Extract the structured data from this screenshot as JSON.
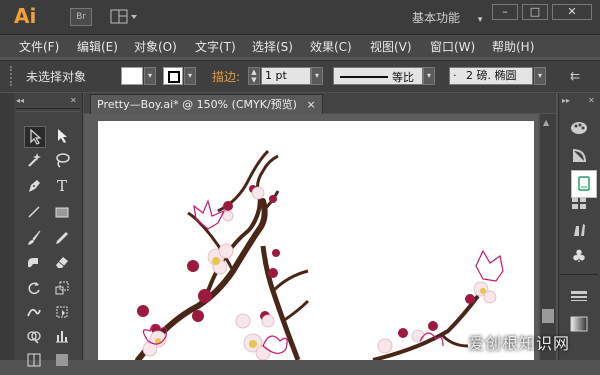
{
  "app": {
    "logo": "Ai",
    "bridge": "Br",
    "workspace": "基本功能",
    "window_controls": [
      "–",
      "□",
      "✕"
    ]
  },
  "menu": [
    "文件(F)",
    "编辑(E)",
    "对象(O)",
    "文字(T)",
    "选择(S)",
    "效果(C)",
    "视图(V)",
    "窗口(W)",
    "帮助(H)"
  ],
  "control": {
    "selection_status": "未选择对象",
    "stroke_label": "描边:",
    "stroke_weight": "1 pt",
    "stroke_profile": "等比",
    "brush_value": "2 磅. 椭圆",
    "brush_dot": "·"
  },
  "document": {
    "tab_title": "Pretty—Boy.ai* @ 150% (CMYK/预览)",
    "close": "×"
  },
  "colors": {
    "accent": "#f2a03a",
    "stroke_label_color": "#e89a36",
    "blossom": "#c8176e",
    "branch": "#4a2618"
  },
  "watermark": "爱创根知识网"
}
